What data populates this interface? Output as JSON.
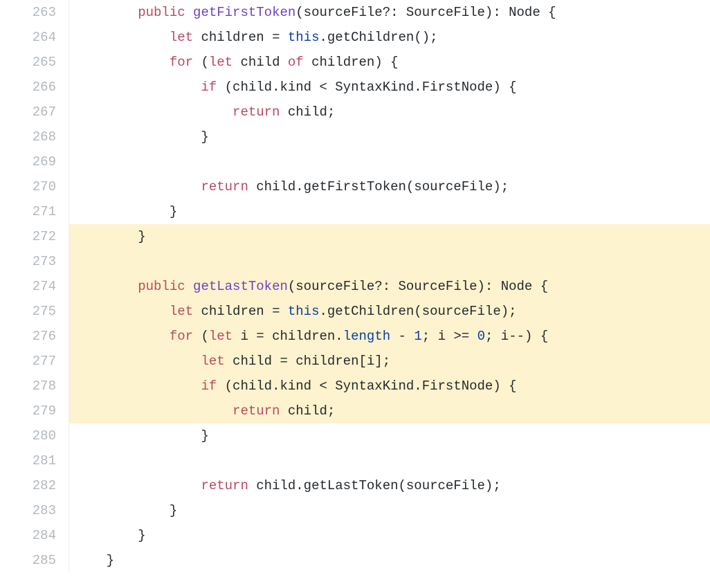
{
  "startLine": 263,
  "lines": [
    {
      "hl": false,
      "tokens": [
        {
          "t": "        ",
          "c": "tok-id"
        },
        {
          "t": "public",
          "c": "tok-kw"
        },
        {
          "t": " ",
          "c": "tok-id"
        },
        {
          "t": "getFirstToken",
          "c": "tok-fn"
        },
        {
          "t": "(sourceFile?: SourceFile): Node {",
          "c": "tok-punc"
        }
      ]
    },
    {
      "hl": false,
      "tokens": [
        {
          "t": "            ",
          "c": "tok-id"
        },
        {
          "t": "let",
          "c": "tok-kw"
        },
        {
          "t": " children = ",
          "c": "tok-id"
        },
        {
          "t": "this",
          "c": "tok-this"
        },
        {
          "t": ".getChildren();",
          "c": "tok-id"
        }
      ]
    },
    {
      "hl": false,
      "tokens": [
        {
          "t": "            ",
          "c": "tok-id"
        },
        {
          "t": "for",
          "c": "tok-kw"
        },
        {
          "t": " (",
          "c": "tok-punc"
        },
        {
          "t": "let",
          "c": "tok-kw"
        },
        {
          "t": " child ",
          "c": "tok-id"
        },
        {
          "t": "of",
          "c": "tok-kw"
        },
        {
          "t": " children) {",
          "c": "tok-id"
        }
      ]
    },
    {
      "hl": false,
      "tokens": [
        {
          "t": "                ",
          "c": "tok-id"
        },
        {
          "t": "if",
          "c": "tok-kw"
        },
        {
          "t": " (child.kind < SyntaxKind.FirstNode) {",
          "c": "tok-id"
        }
      ]
    },
    {
      "hl": false,
      "tokens": [
        {
          "t": "                    ",
          "c": "tok-id"
        },
        {
          "t": "return",
          "c": "tok-kw"
        },
        {
          "t": " child;",
          "c": "tok-id"
        }
      ]
    },
    {
      "hl": false,
      "tokens": [
        {
          "t": "                }",
          "c": "tok-id"
        }
      ]
    },
    {
      "hl": false,
      "tokens": [
        {
          "t": "",
          "c": "tok-id"
        }
      ]
    },
    {
      "hl": false,
      "tokens": [
        {
          "t": "                ",
          "c": "tok-id"
        },
        {
          "t": "return",
          "c": "tok-kw"
        },
        {
          "t": " child.getFirstToken(sourceFile);",
          "c": "tok-id"
        }
      ]
    },
    {
      "hl": false,
      "tokens": [
        {
          "t": "            }",
          "c": "tok-id"
        }
      ]
    },
    {
      "hl": true,
      "tokens": [
        {
          "t": "        }",
          "c": "tok-id"
        }
      ]
    },
    {
      "hl": true,
      "tokens": [
        {
          "t": "",
          "c": "tok-id"
        }
      ]
    },
    {
      "hl": true,
      "tokens": [
        {
          "t": "        ",
          "c": "tok-id"
        },
        {
          "t": "public",
          "c": "tok-kw"
        },
        {
          "t": " ",
          "c": "tok-id"
        },
        {
          "t": "getLastToken",
          "c": "tok-fn"
        },
        {
          "t": "(sourceFile?: SourceFile): Node {",
          "c": "tok-punc"
        }
      ]
    },
    {
      "hl": true,
      "tokens": [
        {
          "t": "            ",
          "c": "tok-id"
        },
        {
          "t": "let",
          "c": "tok-kw"
        },
        {
          "t": " children = ",
          "c": "tok-id"
        },
        {
          "t": "this",
          "c": "tok-this"
        },
        {
          "t": ".getChildren(sourceFile);",
          "c": "tok-id"
        }
      ]
    },
    {
      "hl": true,
      "tokens": [
        {
          "t": "            ",
          "c": "tok-id"
        },
        {
          "t": "for",
          "c": "tok-kw"
        },
        {
          "t": " (",
          "c": "tok-punc"
        },
        {
          "t": "let",
          "c": "tok-kw"
        },
        {
          "t": " i = children.",
          "c": "tok-id"
        },
        {
          "t": "length",
          "c": "tok-prop"
        },
        {
          "t": " - ",
          "c": "tok-id"
        },
        {
          "t": "1",
          "c": "tok-num"
        },
        {
          "t": "; i >= ",
          "c": "tok-id"
        },
        {
          "t": "0",
          "c": "tok-num"
        },
        {
          "t": "; i--) {",
          "c": "tok-id"
        }
      ]
    },
    {
      "hl": true,
      "tokens": [
        {
          "t": "                ",
          "c": "tok-id"
        },
        {
          "t": "let",
          "c": "tok-kw"
        },
        {
          "t": " child = children[i];",
          "c": "tok-id"
        }
      ]
    },
    {
      "hl": true,
      "tokens": [
        {
          "t": "                ",
          "c": "tok-id"
        },
        {
          "t": "if",
          "c": "tok-kw"
        },
        {
          "t": " (child.kind < SyntaxKind.FirstNode) {",
          "c": "tok-id"
        }
      ]
    },
    {
      "hl": true,
      "tokens": [
        {
          "t": "                    ",
          "c": "tok-id"
        },
        {
          "t": "return",
          "c": "tok-kw"
        },
        {
          "t": " child;",
          "c": "tok-id"
        }
      ]
    },
    {
      "hl": false,
      "tokens": [
        {
          "t": "                }",
          "c": "tok-id"
        }
      ]
    },
    {
      "hl": false,
      "tokens": [
        {
          "t": "",
          "c": "tok-id"
        }
      ]
    },
    {
      "hl": false,
      "tokens": [
        {
          "t": "                ",
          "c": "tok-id"
        },
        {
          "t": "return",
          "c": "tok-kw"
        },
        {
          "t": " child.getLastToken(sourceFile);",
          "c": "tok-id"
        }
      ]
    },
    {
      "hl": false,
      "tokens": [
        {
          "t": "            }",
          "c": "tok-id"
        }
      ]
    },
    {
      "hl": false,
      "tokens": [
        {
          "t": "        }",
          "c": "tok-id"
        }
      ]
    },
    {
      "hl": false,
      "tokens": [
        {
          "t": "    }",
          "c": "tok-id"
        }
      ]
    }
  ]
}
